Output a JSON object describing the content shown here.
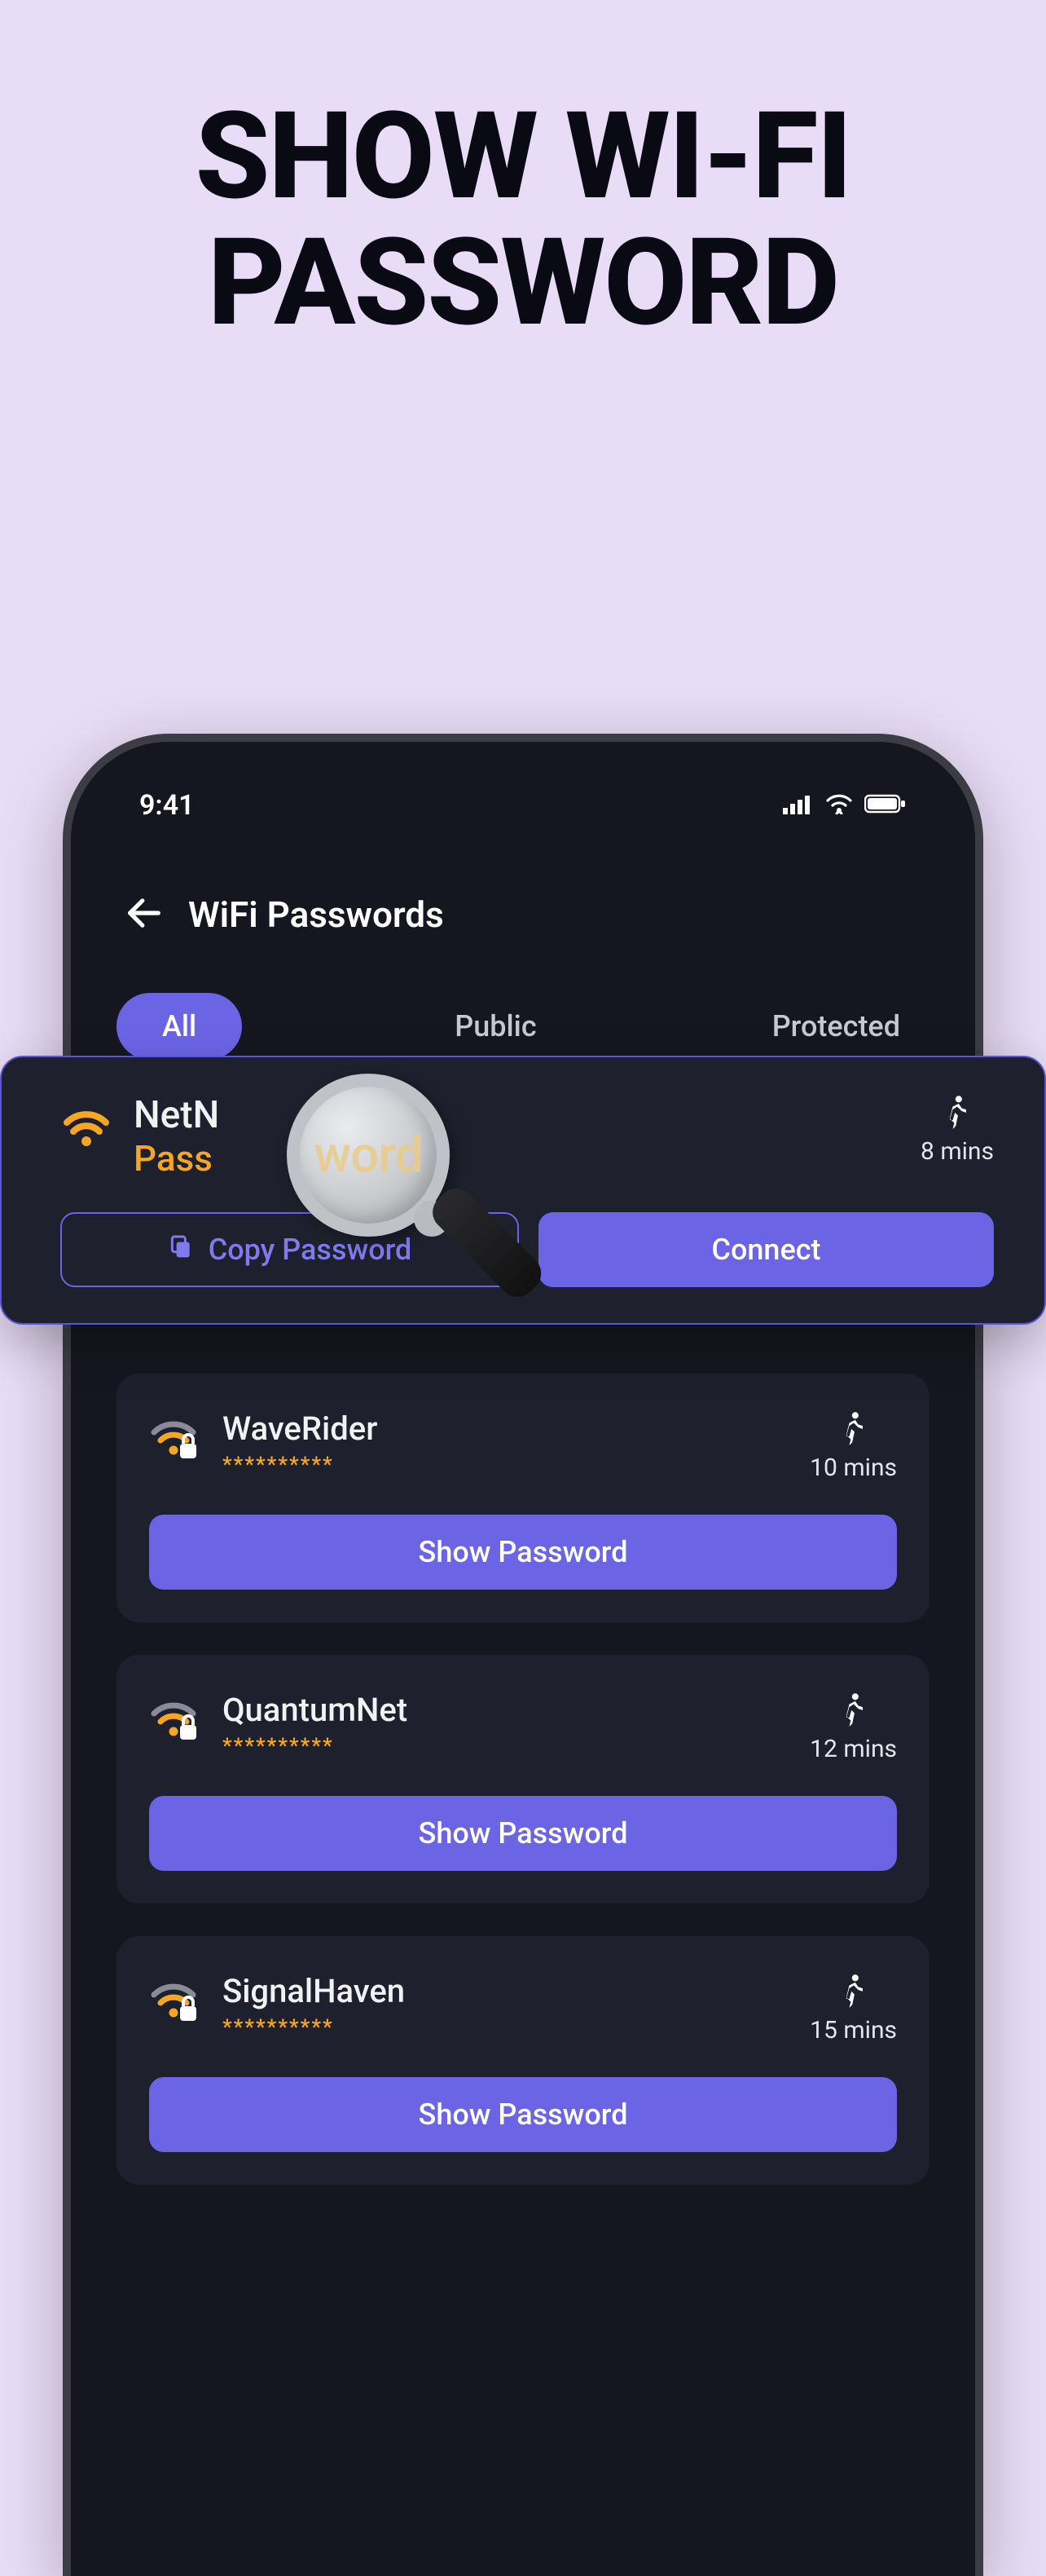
{
  "hero": {
    "line1": "SHOW WI-FI",
    "line2": "PASSWORD"
  },
  "status": {
    "time": "9:41"
  },
  "header": {
    "title": "WiFi Passwords"
  },
  "tabs": {
    "all": "All",
    "public": "Public",
    "protected": "Protected"
  },
  "featured": {
    "name": "NetN",
    "password_prefix": "Pass",
    "magnified_text": "word",
    "walk_time": "8 mins",
    "copy_label": "Copy Password",
    "connect_label": "Connect"
  },
  "networks": [
    {
      "name": "WaveRider",
      "mask": "**********",
      "walk_time": "10 mins",
      "btn": "Show Password"
    },
    {
      "name": "QuantumNet",
      "mask": "**********",
      "walk_time": "12 mins",
      "btn": "Show Password"
    },
    {
      "name": "SignalHaven",
      "mask": "**********",
      "walk_time": "15 mins",
      "btn": "Show Password"
    }
  ]
}
